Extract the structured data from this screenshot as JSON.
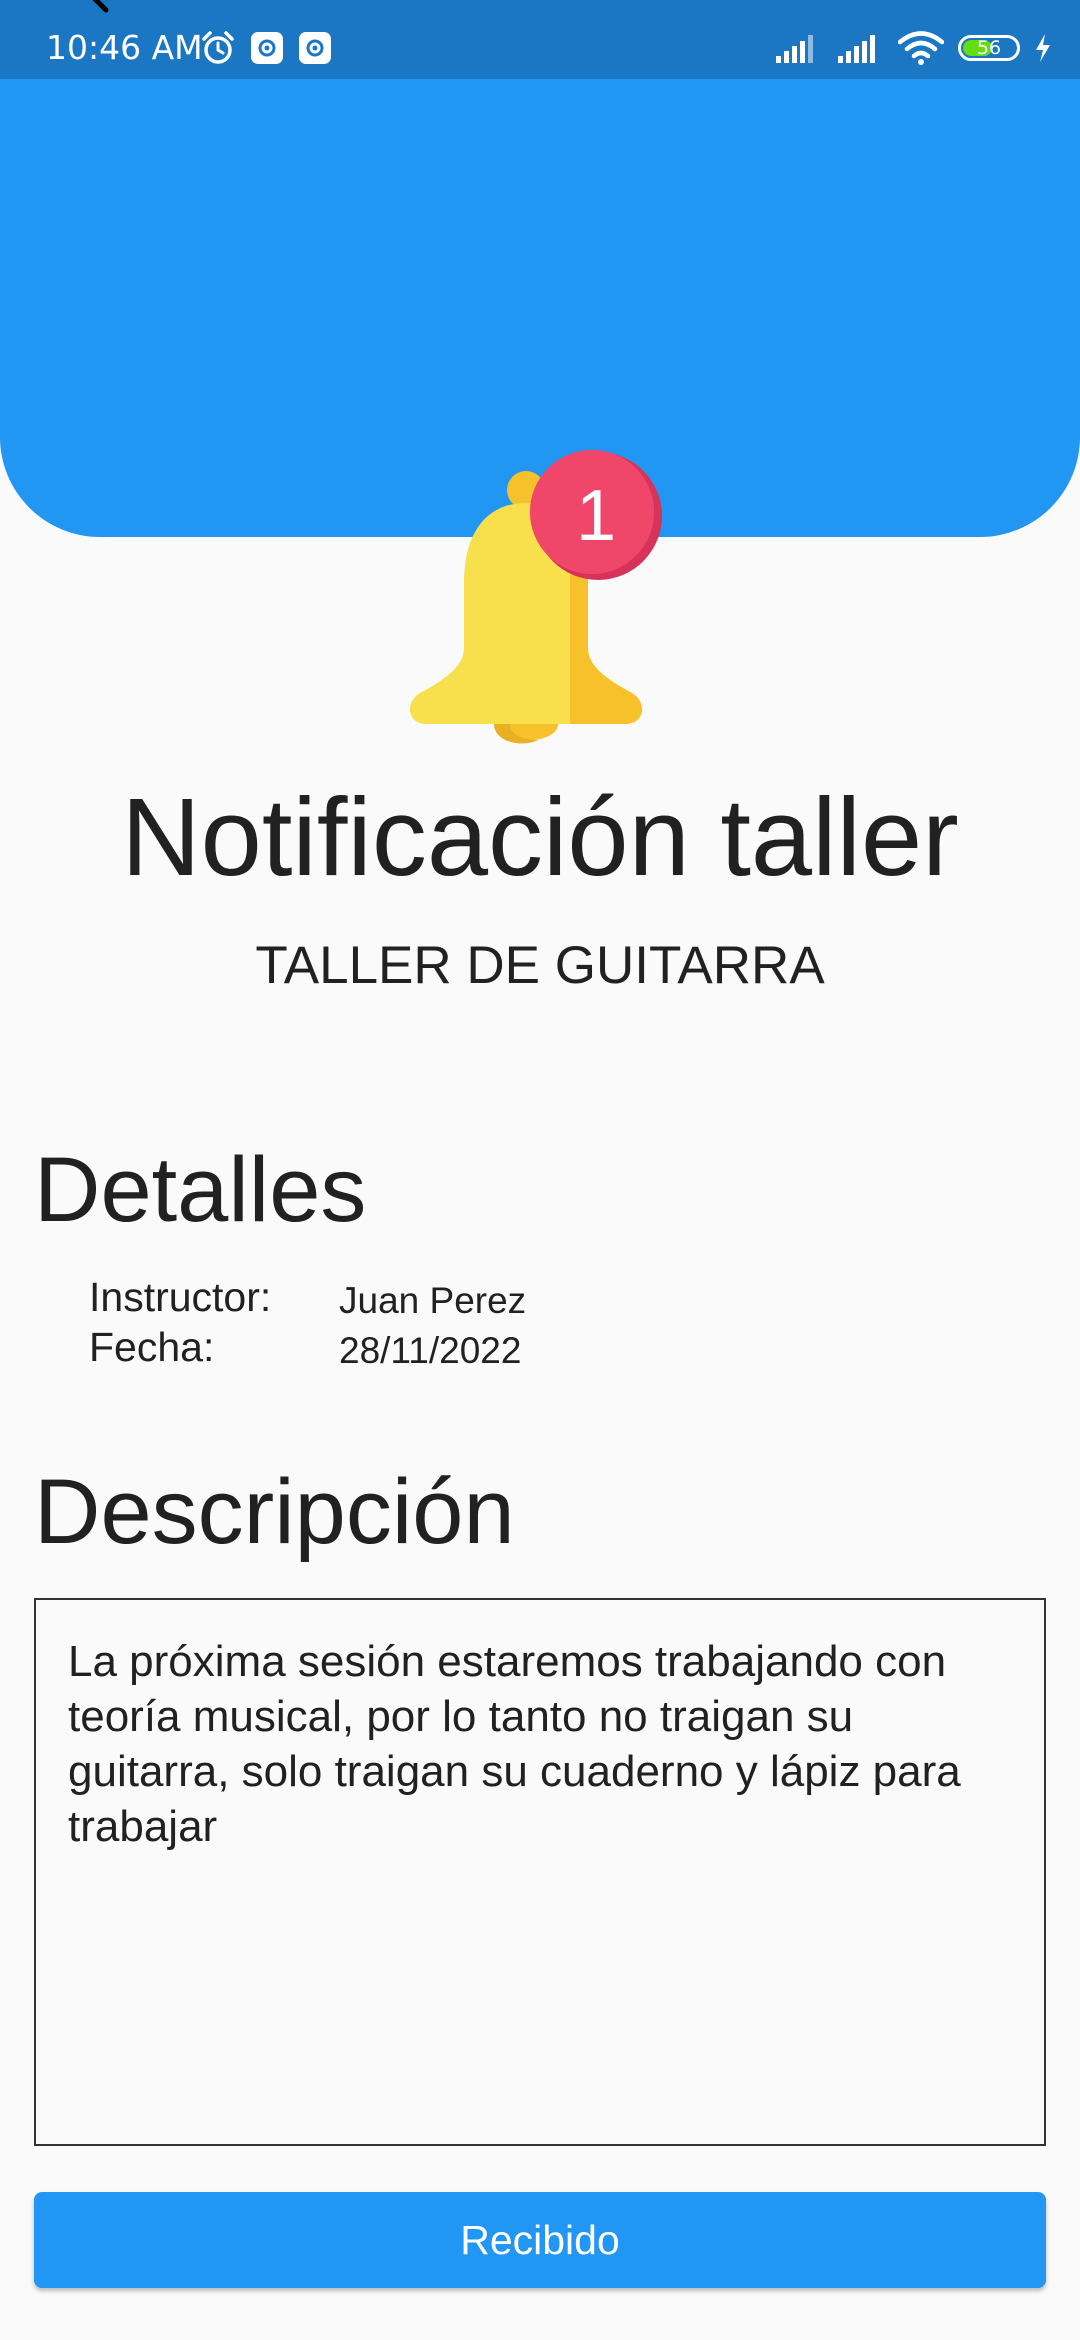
{
  "status_bar": {
    "time": "10:46 AM",
    "battery_level": "56",
    "battery_fraction": 0.56,
    "left_icons": [
      "alarm-icon",
      "settings-app-icon",
      "settings-app-icon"
    ],
    "right_icons": [
      "signal-icon",
      "signal-icon",
      "wifi-icon",
      "battery-icon",
      "charging-icon"
    ]
  },
  "notification": {
    "badge_count": "1",
    "title": "Notificación taller",
    "subtitle": "TALLER DE GUITARRA"
  },
  "details": {
    "heading": "Detalles",
    "instructor_label": "Instructor:",
    "instructor_value": "Juan Perez",
    "date_label": "Fecha:",
    "date_value": "28/11/2022"
  },
  "description": {
    "heading": "Descripción",
    "text": "La próxima sesión estaremos trabajando con teoría musical, por lo tanto no traigan su guitarra, solo traigan su cuaderno y lápiz para trabajar"
  },
  "actions": {
    "received_label": "Recibido"
  },
  "colors": {
    "status_bar": "#1b76c3",
    "header": "#2196f3",
    "button": "#2196f3",
    "bell": "#f7e04b",
    "badge": "#f0466a"
  }
}
